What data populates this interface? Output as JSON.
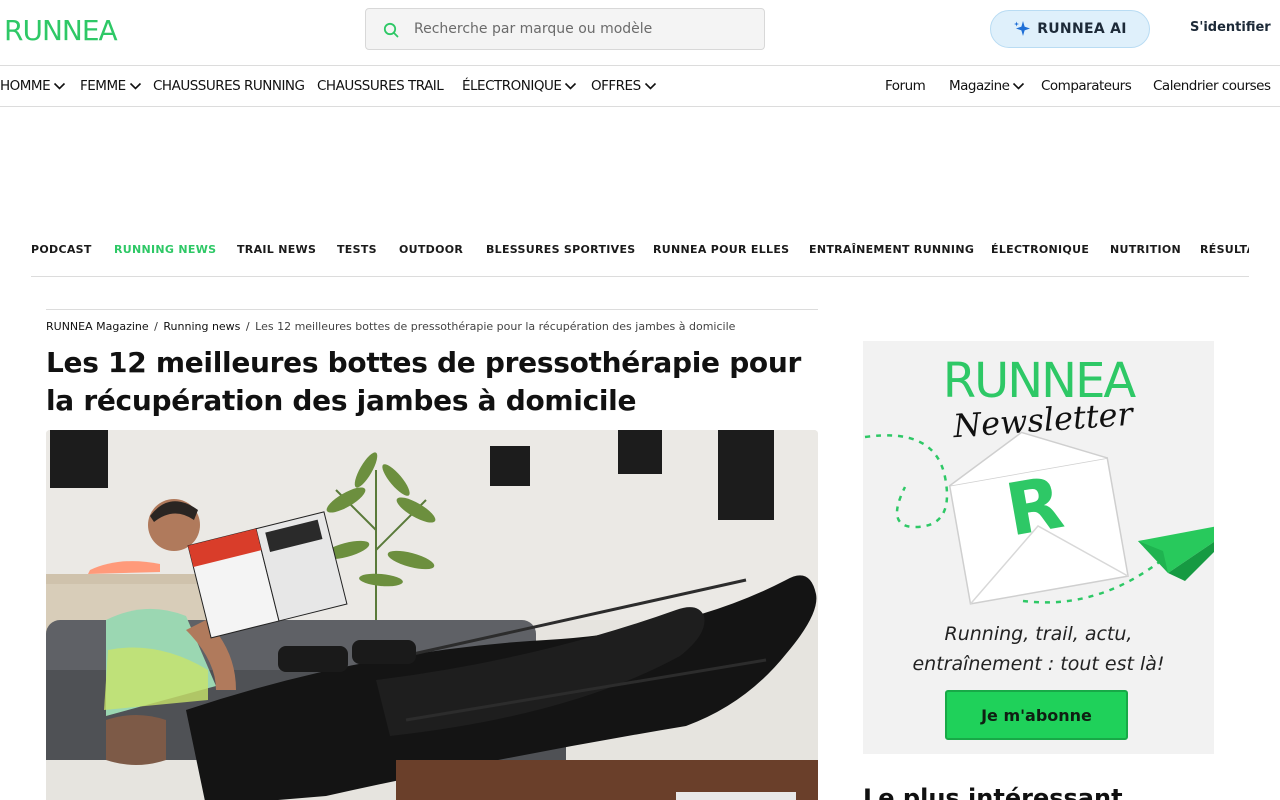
{
  "header": {
    "logo": "RUNNEA",
    "search_placeholder": "Recherche par marque ou modèle",
    "ai_button": "RUNNEA AI",
    "login": "S'identifier"
  },
  "main_nav": {
    "left": [
      {
        "label": "HOMME",
        "dropdown": true
      },
      {
        "label": "FEMME",
        "dropdown": true
      },
      {
        "label": "CHAUSSURES RUNNING",
        "dropdown": false
      },
      {
        "label": "CHAUSSURES TRAIL",
        "dropdown": false
      },
      {
        "label": "ÉLECTRONIQUE",
        "dropdown": true
      },
      {
        "label": "OFFRES",
        "dropdown": true
      }
    ],
    "right": [
      {
        "label": "Forum",
        "dropdown": false
      },
      {
        "label": "Magazine",
        "dropdown": true
      },
      {
        "label": "Comparateurs",
        "dropdown": false
      },
      {
        "label": "Calendrier courses",
        "dropdown": false
      }
    ]
  },
  "categories": {
    "items": [
      "PODCAST",
      "RUNNING NEWS",
      "TRAIL NEWS",
      "TESTS",
      "OUTDOOR",
      "BLESSURES SPORTIVES",
      "RUNNEA POUR ELLES",
      "ENTRAÎNEMENT RUNNING",
      "ÉLECTRONIQUE",
      "NUTRITION",
      "RÉSULTA"
    ],
    "active_index": 1
  },
  "article": {
    "breadcrumb": [
      "RUNNEA Magazine",
      "Running news",
      "Les 12 meilleures bottes de pressothérapie pour la récupération des jambes à domicile"
    ],
    "breadcrumb_sep": "/",
    "title_line1": "Les 12 meilleures bottes de pressothérapie pour",
    "title_line2": "la récupération des jambes à domicile"
  },
  "sidebar": {
    "newsletter": {
      "logo": "RUNNEA",
      "script": "Newsletter",
      "tagline_line1": "Running, trail, actu,",
      "tagline_line2": "entraînement : tout est là!",
      "button": "Je m'abonne"
    },
    "section_heading": "Le plus intéressant"
  },
  "colors": {
    "brand_green": "#2ec866",
    "ai_button_bg": "#dff0fb",
    "nl_button": "#1fd15a",
    "border": "#dcdcdc"
  }
}
